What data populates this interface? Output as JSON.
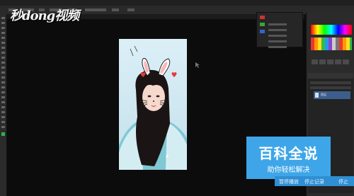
{
  "watermark": {
    "text": "秒dong视频"
  },
  "brand": {
    "title": "百科全说",
    "subtitle": "助你轻松解决"
  },
  "footer": {
    "item1": "暂停播放",
    "item2": "停止记录",
    "item3": "停止"
  },
  "layers": {
    "layer_label": "图层"
  },
  "colors": {
    "accent": "#3ea6e8",
    "tool_foreground": "#2fb34a",
    "layer_selected": "#3d5e8c"
  },
  "icons": [
    "heart-icon",
    "cursor-icon",
    "bunny-ears-icon"
  ]
}
